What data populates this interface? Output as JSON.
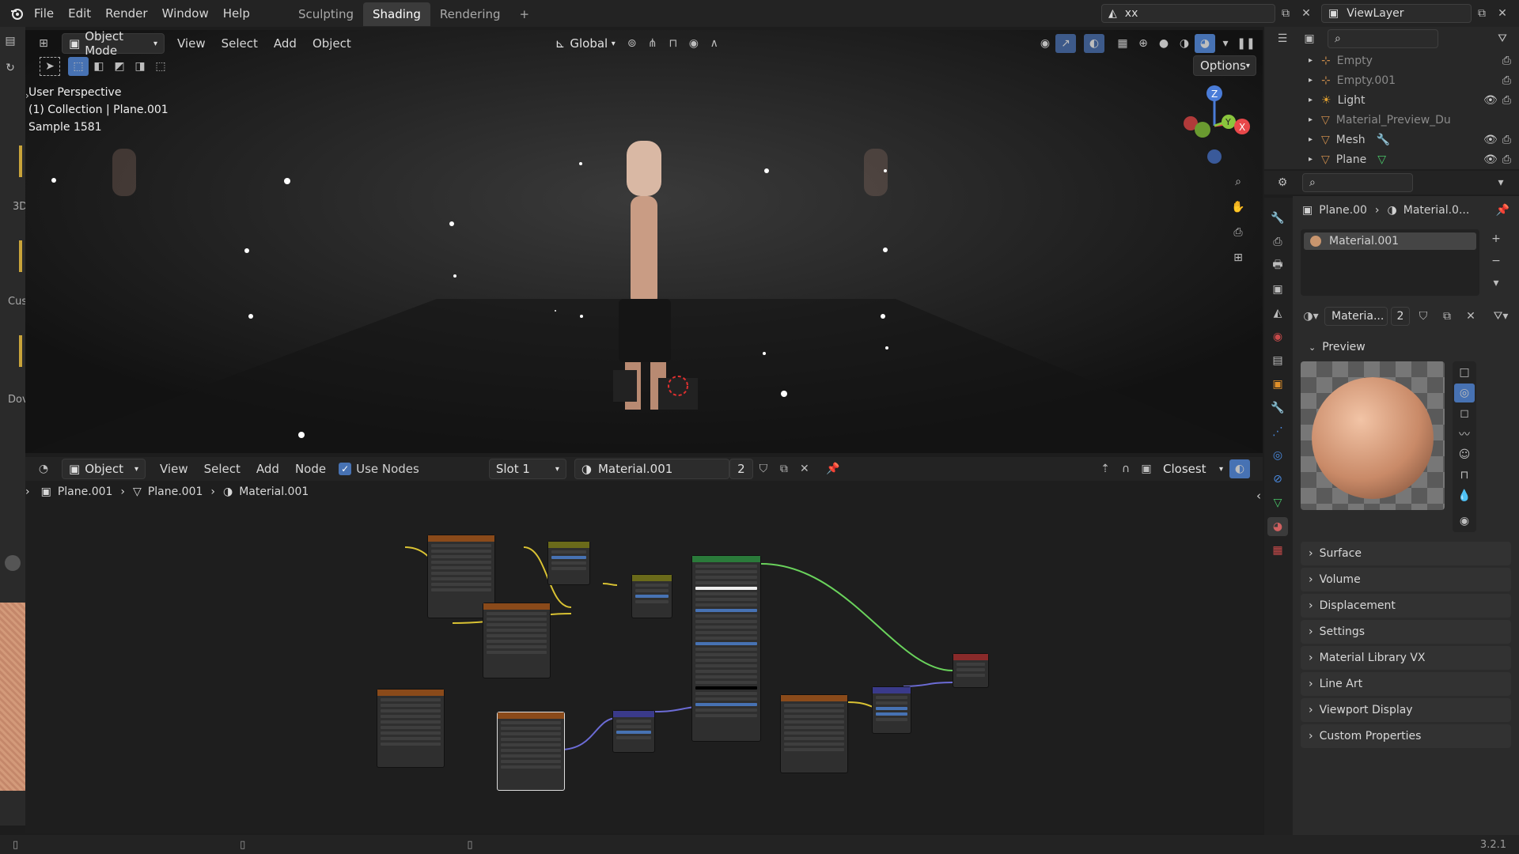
{
  "topbar": {
    "menus": [
      "File",
      "Edit",
      "Render",
      "Window",
      "Help"
    ],
    "workspaces": [
      "Sculpting",
      "Shading",
      "Rendering"
    ],
    "active_workspace": "Shading",
    "scene_name": "xx",
    "view_layer": "ViewLayer"
  },
  "viewport": {
    "mode": "Object Mode",
    "menus": [
      "View",
      "Select",
      "Add",
      "Object"
    ],
    "orientation": "Global",
    "options_label": "Options",
    "overlay": [
      "User Perspective",
      "(1) Collection | Plane.001",
      "Sample 1581"
    ],
    "gizmo_axes": [
      "Z",
      "Y",
      "X"
    ]
  },
  "left_partial_labels": [
    "3D",
    "Cus",
    "Dov"
  ],
  "node_editor": {
    "type": "Object",
    "menus": [
      "View",
      "Select",
      "Add",
      "Node"
    ],
    "use_nodes_label": "Use Nodes",
    "slot": "Slot 1",
    "material": "Material.001",
    "users": "2",
    "snap": "Closest",
    "breadcrumb": [
      "Plane.001",
      "Plane.001",
      "Material.001"
    ]
  },
  "outliner": {
    "items": [
      "Empty",
      "Empty.001",
      "Light",
      "Material_Preview_Du",
      "Mesh",
      "Plane"
    ]
  },
  "properties": {
    "breadcrumb": [
      "Plane.00",
      "Material.0..."
    ],
    "material_slot": "Material.001",
    "material_name": "Materia...",
    "users": "2",
    "panels": [
      "Preview",
      "Surface",
      "Volume",
      "Displacement",
      "Settings",
      "Material Library VX",
      "Line Art",
      "Viewport Display",
      "Custom Properties"
    ]
  },
  "status": {
    "version": "3.2.1"
  },
  "colors": {
    "accent": "#4772b3",
    "bg": "#1d1d1d",
    "node_wire_green": "#6ad35c",
    "node_wire_yellow": "#d9c233",
    "node_wire_purple": "#6c6cd6"
  }
}
